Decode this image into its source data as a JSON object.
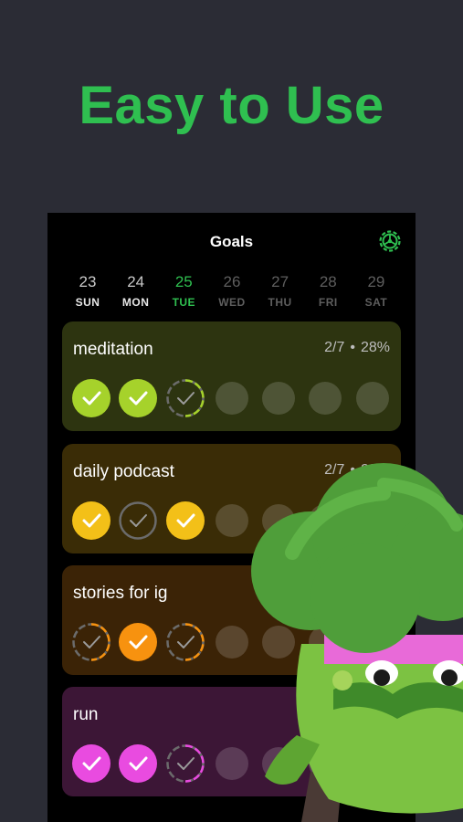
{
  "headline": "Easy to Use",
  "app": {
    "title": "Goals",
    "settings_icon": "gear-icon"
  },
  "colors": {
    "accent": "#2fbf50",
    "bg": "#2b2c35"
  },
  "days": [
    {
      "num": "23",
      "label": "SUN",
      "state": "past"
    },
    {
      "num": "24",
      "label": "MON",
      "state": "past"
    },
    {
      "num": "25",
      "label": "TUE",
      "state": "today"
    },
    {
      "num": "26",
      "label": "WED",
      "state": "future"
    },
    {
      "num": "27",
      "label": "THU",
      "state": "future"
    },
    {
      "num": "28",
      "label": "FRI",
      "state": "future"
    },
    {
      "num": "29",
      "label": "SAT",
      "state": "future"
    }
  ],
  "goals": [
    {
      "name": "meditation",
      "count": "2/7",
      "percent": "28%",
      "color": "#a6d22b",
      "bg": "#2d3410",
      "days": [
        "done",
        "done",
        "partial",
        "empty",
        "empty",
        "empty",
        "empty"
      ]
    },
    {
      "name": "daily podcast",
      "count": "2/7",
      "percent": "28%",
      "color": "#f3c018",
      "bg": "#3a2c06",
      "days": [
        "done",
        "skip",
        "done",
        "empty",
        "empty",
        "empty",
        "empty"
      ]
    },
    {
      "name": "stories for ig",
      "count": "",
      "percent": "",
      "color": "#f7920f",
      "bg": "#3b2306",
      "days": [
        "partial",
        "done",
        "partial",
        "empty",
        "empty",
        "empty",
        "empty"
      ]
    },
    {
      "name": "run",
      "count": "",
      "percent": "",
      "color": "#e94be0",
      "bg": "#3c1636",
      "days": [
        "done",
        "done",
        "partial",
        "empty",
        "empty",
        "empty",
        "empty"
      ]
    }
  ]
}
